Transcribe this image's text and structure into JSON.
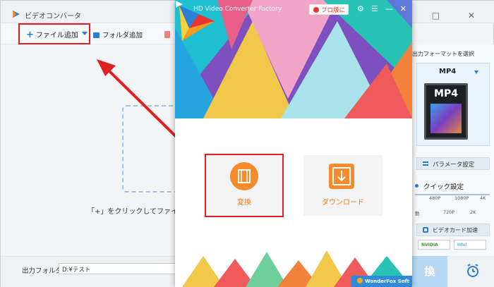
{
  "bg_window": {
    "title": "ビデオコンバータ",
    "controls": "— □ ✕",
    "toolbar": {
      "add_file_label": "ファイル追加",
      "add_folder_label": "フォルダ追加"
    },
    "hint": "「+」をクリックしてファイルを追加",
    "output_folder_label": "出力フォルダ：",
    "output_folder_value": "D:¥テスト",
    "right_panel": {
      "title": "出力フォーマットを選択",
      "format": "MP4",
      "tile_text": "MP4",
      "param_label": "パラメータ設定",
      "quick_label": "クイック設定",
      "quality_top": [
        "480P",
        "1080P",
        "4K"
      ],
      "quality_bottom": [
        "動",
        "720P",
        "2K"
      ],
      "gpu_label": "ビデオカード加速",
      "gpu_chips": [
        "NVIDIA",
        "Intel"
      ],
      "convert_label": "換"
    }
  },
  "fg_window": {
    "title": "HD Video Converter Factory",
    "pro_label": "プロ版に",
    "icons": "⚙☰—✕",
    "tiles": {
      "convert_label": "変換",
      "download_label": "ダウンロード"
    },
    "brand": "WonderFox Soft"
  },
  "colors": {
    "accent_blue": "#2b7bd6",
    "orange": "#f58b2a",
    "highlight_red": "#e02020"
  }
}
